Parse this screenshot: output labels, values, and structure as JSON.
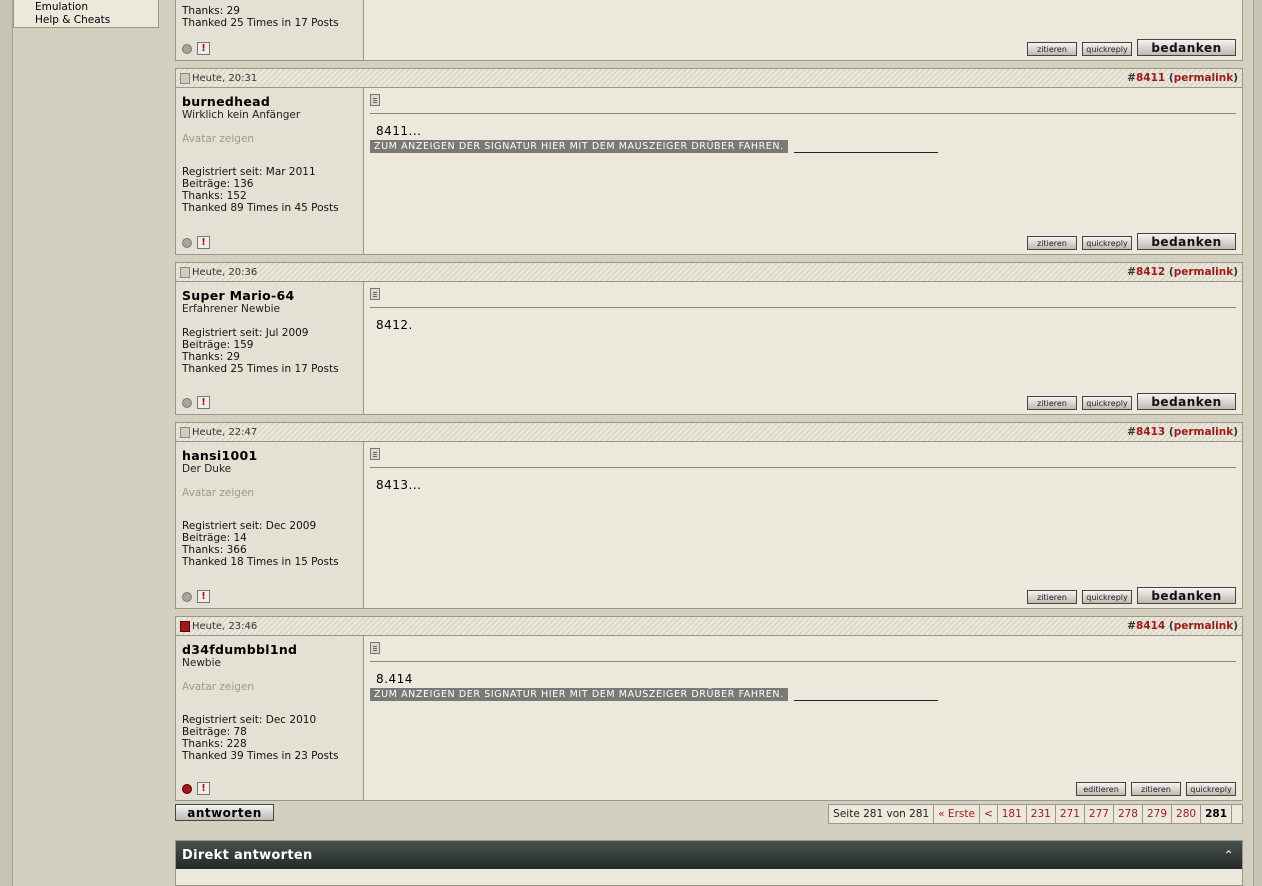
{
  "sidebar": {
    "items": [
      "Emulation",
      "Help & Cheats"
    ]
  },
  "top_post": {
    "thanks": "Thanks: 29",
    "thanked": "Thanked 25 Times in 17 Posts"
  },
  "posts": [
    {
      "date": "Heute, 20:31",
      "num": "8411",
      "permalink": "permalink",
      "username": "burnedhead",
      "usertitle": "Wirklich kein Anfänger",
      "avatar": "Avatar zeigen",
      "registered": "Registriert seit: Mar 2011",
      "posts": "Beiträge: 136",
      "thanks": "Thanks: 152",
      "thanked": "Thanked 89 Times in 45 Posts",
      "message": "8411...",
      "signature": "ZUM ANZEIGEN DER SIGNATUR HIER MIT DEM MAUSZEIGER DRÜBER FAHREN."
    },
    {
      "date": "Heute, 20:36",
      "num": "8412",
      "permalink": "permalink",
      "username": "Super Mario-64",
      "usertitle": "Erfahrener Newbie",
      "registered": "Registriert seit: Jul 2009",
      "posts": "Beiträge: 159",
      "thanks": "Thanks: 29",
      "thanked": "Thanked 25 Times in 17 Posts",
      "message": "8412."
    },
    {
      "date": "Heute, 22:47",
      "num": "8413",
      "permalink": "permalink",
      "username": "hansi1001",
      "usertitle": "Der Duke",
      "avatar": "Avatar zeigen",
      "registered": "Registriert seit: Dec 2009",
      "posts": "Beiträge: 14",
      "thanks": "Thanks: 366",
      "thanked": "Thanked 18 Times in 15 Posts",
      "message": "8413..."
    },
    {
      "date": "Heute, 23:46",
      "num": "8414",
      "permalink": "permalink",
      "username": "d34fdumbbl1nd",
      "usertitle": "Newbie",
      "avatar": "Avatar zeigen",
      "registered": "Registriert seit: Dec 2010",
      "posts": "Beiträge: 78",
      "thanks": "Thanks: 228",
      "thanked": "Thanked 39 Times in 23 Posts",
      "message": "8.414",
      "signature": "ZUM ANZEIGEN DER SIGNATUR HIER MIT DEM MAUSZEIGER DRÜBER FAHREN."
    }
  ],
  "buttons": {
    "quote": "zitieren",
    "quickreply": "quickreply",
    "thank": "bedanken",
    "edit": "editieren",
    "reply": "antworten"
  },
  "pager": {
    "label": "Seite 281 von 281",
    "first": "« Erste",
    "prev": "<",
    "pages": [
      "181",
      "231",
      "271",
      "277",
      "278",
      "279",
      "280"
    ],
    "current": "281"
  },
  "quick_reply": {
    "title": "Direkt antworten",
    "collapse_icon": "collapse-up-icon"
  }
}
